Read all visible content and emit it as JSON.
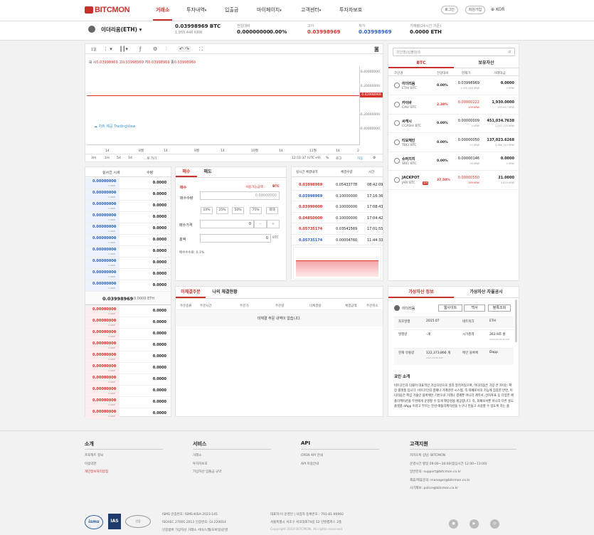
{
  "header": {
    "logo": "BITCMON",
    "nav": [
      {
        "label": "거래소",
        "arrow": ""
      },
      {
        "label": "투자내역",
        "arrow": "▾"
      },
      {
        "label": "입출금",
        "arrow": ""
      },
      {
        "label": "마이페이지",
        "arrow": "▾"
      },
      {
        "label": "고객센터",
        "arrow": "▾"
      },
      {
        "label": "투자자보호",
        "arrow": ""
      }
    ],
    "login": "로그인",
    "signup": "회원가입",
    "lang": "KOR"
  },
  "ticker": {
    "coin": "이더리움(ETH)",
    "price_btc": "0.03998969 BTC",
    "price_krw": "1,955,446 KRW",
    "change_label": "전일대비",
    "change_value": "0.00000000",
    "change_pct": "0.00%",
    "high_label": "고가",
    "high_value": "0.03998969",
    "low_label": "저가",
    "low_value": "0.03998969",
    "volume_label": "거래량(24시간 기준)",
    "volume_value": "0.0000 ETH"
  },
  "chart": {
    "interval": "1일",
    "ohlc": [
      "시",
      "0.03998969",
      "고",
      "0.03998969",
      "저",
      "0.03998969",
      "종",
      "0.03998969"
    ],
    "y_ticks": [
      "0.40000000",
      "0.20000000",
      "0.03998969",
      "-0.20000000",
      "-0.40000000"
    ],
    "x_ticks": [
      "14",
      "8월",
      "14",
      "9월",
      "14",
      "10월",
      "14",
      "11월",
      "14",
      "2"
    ],
    "ranges": [
      "3m",
      "1m",
      "5d",
      "1d",
      "...로 가기"
    ],
    "clock": "12:51:37 (UTC+9)",
    "pct": "%",
    "log": "로그",
    "auto": "자동",
    "watermark": "차트 제공 TradingView"
  },
  "market": {
    "search_placeholder": "코인명/심볼검색",
    "tabs": [
      "BTC",
      "보유자산"
    ],
    "cols": [
      "코인명",
      "전일대비",
      "현재가",
      "거래대금"
    ],
    "rows": [
      {
        "name": "이더리움",
        "sym": "ETH/ BTC",
        "change": "0.00%",
        "change_color": "#222",
        "price": "0.03998969",
        "price_krw": "1,955,446 KRW",
        "vol": "0.0000",
        "vol_krw": "0 KRW"
      },
      {
        "name": "카이바",
        "sym": "CAV/ BTC",
        "change": "2.38%",
        "change_color": "#d9332c",
        "price": "0.00000222",
        "price_krw": "109 KRW",
        "vol": "1,930.0000",
        "vol_krw": "203,917 KRW"
      },
      {
        "name": "씨캐시",
        "sym": "CCASH/ BTC",
        "change": "0.00%",
        "change_color": "#222",
        "price": "0.00000009",
        "price_krw": "4 KRW",
        "vol": "451,034.7638",
        "vol_krw": "2,007,276 KRW"
      },
      {
        "name": "티보체인",
        "sym": "TBC/ BTC",
        "change": "0.00%",
        "change_color": "#222",
        "price": "0.00000050",
        "price_krw": "24 KRW",
        "vol": "137,023.6268",
        "vol_krw": "3,386,743 KRW"
      },
      {
        "name": "슈퍼치치",
        "sym": "SRC/ BTC",
        "change": "0.00%",
        "change_color": "#222",
        "price": "0.00000146",
        "price_krw": "56 KRW",
        "vol": "0.0000",
        "vol_krw": "0 KRW"
      },
      {
        "name": "JACKPOT",
        "sym": "JAP/ BTC",
        "badge": "유의",
        "change": "37.50%",
        "change_color": "#d9332c",
        "price": "0.00000550",
        "price_krw": "269 KRW",
        "vol": "21.0000",
        "vol_krw": "5,629 KRW"
      }
    ]
  },
  "orderbook": {
    "cols": [
      "실시간 시세",
      "수량"
    ],
    "asks": [
      "0.00000000",
      "0.00000000",
      "0.00000000",
      "0.00000000",
      "0.00000000",
      "0.00000000",
      "0.00000000",
      "0.00000000",
      "0.00000000",
      "0.00000000"
    ],
    "ask_amounts": [
      "0.0000",
      "0.0000",
      "0.0000",
      "0.0000",
      "0.0000",
      "0.0000",
      "0.0000",
      "0.0000",
      "0.0000",
      "0.0000"
    ],
    "krw": "0 KRW",
    "current": "0.03998969",
    "current_eth": "0.0000 ETH",
    "bids": [
      "0.00000000",
      "0.00000000",
      "0.00000000",
      "0.00000000",
      "0.00000000",
      "0.00000000",
      "0.00000000",
      "0.00000000",
      "0.00000000",
      "0.00000000"
    ],
    "bid_amounts": [
      "0.0000",
      "0.0000",
      "0.0000",
      "0.0000",
      "0.0000",
      "0.0000",
      "0.0000",
      "0.0000",
      "0.0000",
      "0.0000"
    ]
  },
  "trade": {
    "tabs": [
      "매수",
      "매도"
    ],
    "buy_label": "매수",
    "avail_label": "사용가능금액 :",
    "avail_unit": "BTC",
    "qty_label": "매수수량",
    "qty_placeholder": "0.00000000",
    "pcts": [
      "10%",
      "25%",
      "50%",
      "75%",
      "최대"
    ],
    "price_label": "매수가격",
    "price_value": "0",
    "minus": "−",
    "plus": "+",
    "total_label": "총액",
    "total_value": "0",
    "total_unit": "BTC",
    "fee": "매수수수료: 0.1%"
  },
  "recent": {
    "cols": [
      "실시간 체결내역",
      "체결수량",
      "시간"
    ],
    "rows": [
      {
        "p": "0.03998969",
        "q": "0.05433778",
        "t": "08:42:09",
        "c": "#d9332c"
      },
      {
        "p": "0.03998969",
        "q": "0.10000000",
        "t": "17:16:36",
        "c": "#2a5fc7"
      },
      {
        "p": "0.03999000",
        "q": "0.10000000",
        "t": "17:08:43",
        "c": "#d9332c"
      },
      {
        "p": "0.04850000",
        "q": "0.10000000",
        "t": "17:04:42",
        "c": "#d9332c"
      },
      {
        "p": "0.05735174",
        "q": "0.03541569",
        "t": "17:01:55",
        "c": "#d9332c"
      },
      {
        "p": "0.05735174",
        "q": "0.00004760",
        "t": "11:44:33",
        "c": "#2a5fc7"
      }
    ]
  },
  "orders": {
    "tabs": [
      "미체결주문",
      "나의 체결현황"
    ],
    "cols": [
      "주문종류",
      "주문시간",
      "주문가",
      "주문량",
      "미체결량",
      "체결금액",
      "주문취소"
    ],
    "empty": "미체결 주문 내역이 없습니다."
  },
  "info": {
    "tabs": [
      "가상자산 정보",
      "가상자산 자율공시"
    ],
    "coin": "이더리움",
    "buttons": [
      "웹사이트",
      "백서",
      "블록조회"
    ],
    "rows": [
      {
        "k1": "최초발행",
        "v1": "2015.07",
        "k2": "네트워크",
        "v2": "ETH"
      },
      {
        "k1": "발행량",
        "v1": "-개",
        "k2": "시가총액",
        "v2": "263.9조 원",
        "v2s": "2023.01.05 05 KST"
      },
      {
        "k1": "현재 유통량",
        "v1": "122,373,866 개",
        "v1s": "2023.01.05 KST",
        "k2": "메인 블록체",
        "v2": "Dapp"
      }
    ],
    "intro_title": "코인 소개",
    "intro": "비트코인과 더불어 대표적인 가상자산으로 널리 알려져있으며, 이더리움은 가장 큰 차이는 확장 플랫폼 입니다. 비트코인의 결제나 거래관련 시스템, 즉 화폐로서의 기능에 집중한 반면, 이더리움은 핵심 기술인 블록체인 기반으로 거래나 결제뿐 아니라 계약서, 전자투표 등 다양한 애플리케이션을 두명에게 운영할 수 있게 확장성을 제공합니다. 즉, 화폐로서뿐 아니라 다른 용도 플랫폼 dApp 이라고 부르는 분산 애플리케이션을 누구나 만들고 사용할 수 있도록 하는 플"
  },
  "footer": {
    "cols": [
      {
        "title": "소개",
        "items": [
          "프로젝트 정보",
          "이용약관",
          "개인정보처리방침"
        ]
      },
      {
        "title": "서비스",
        "items": [
          "거래소",
          "투자자보호",
          "가상자산 입출금 규약"
        ]
      },
      {
        "title": "API",
        "items": [
          "OPEN API 안내",
          "API 이용안내"
        ]
      },
      {
        "title": "고객지원",
        "items": [
          "카카오톡 상담: BITCMON",
          "운영시간 평일 09:00~18:00(점심시간 12:00~13:00)",
          "일반문의: support@bitcmon.co.kr",
          "제휴/제휴문의: manager@bitcmon.co.kr",
          "사기제보: police@bitcmon.co.kr"
        ]
      }
    ],
    "cert1": "ISMS 인증번호: ISMS-KISA-2023-145",
    "cert2": "ISO/IEC 27001:2013 인증번호: GI-220014",
    "cert3": "인증범위 가상자산 거래소 서비스(웹/모바일)운영",
    "company1": "대표자:이 운영인 | 사업자 등록번호 : 791-81-00992",
    "company2": "서울특별시 서초구 서초대로74길 52 인텐캠퍼스 2층",
    "copyright": "Copyright 2019 BITCMON. All rights reserved",
    "badges": [
      "isms",
      "IAS",
      "인증"
    ]
  }
}
